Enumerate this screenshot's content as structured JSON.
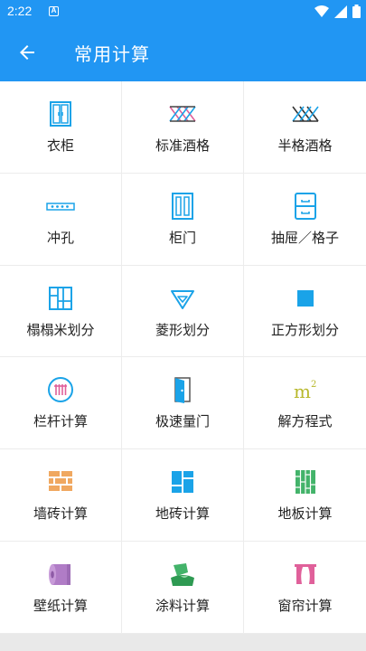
{
  "status_bar": {
    "time": "2:22",
    "notification_letter": "A",
    "icons": [
      "wifi-icon",
      "signal-icon",
      "battery-icon"
    ]
  },
  "header": {
    "title": "常用计算",
    "back_icon": "arrow-left-icon"
  },
  "colors": {
    "primary": "#2196f3",
    "icon_blue": "#1aa3e8",
    "brick_orange": "#f0a860",
    "floor_green": "#43b36a",
    "pink": "#e0609a",
    "olive": "#b8b82c",
    "purple": "#b07cc6"
  },
  "items": [
    {
      "label": "衣柜",
      "icon": "wardrobe-icon"
    },
    {
      "label": "标准酒格",
      "icon": "wine-rack-icon"
    },
    {
      "label": "半格酒格",
      "icon": "half-wine-rack-icon"
    },
    {
      "label": "冲孔",
      "icon": "punch-hole-icon"
    },
    {
      "label": "柜门",
      "icon": "cabinet-door-icon"
    },
    {
      "label": "抽屉／格子",
      "icon": "drawer-icon"
    },
    {
      "label": "榻榻米划分",
      "icon": "tatami-icon"
    },
    {
      "label": "菱形划分",
      "icon": "diamond-icon"
    },
    {
      "label": "正方形划分",
      "icon": "square-icon"
    },
    {
      "label": "栏杆计算",
      "icon": "railing-icon"
    },
    {
      "label": "极速量门",
      "icon": "door-icon"
    },
    {
      "label": "解方程式",
      "icon": "equation-icon"
    },
    {
      "label": "墙砖计算",
      "icon": "wall-tile-icon"
    },
    {
      "label": "地砖计算",
      "icon": "floor-tile-icon"
    },
    {
      "label": "地板计算",
      "icon": "wood-floor-icon"
    },
    {
      "label": "壁纸计算",
      "icon": "wallpaper-icon"
    },
    {
      "label": "涂料计算",
      "icon": "paint-bucket-icon"
    },
    {
      "label": "窗帘计算",
      "icon": "curtain-icon"
    }
  ]
}
